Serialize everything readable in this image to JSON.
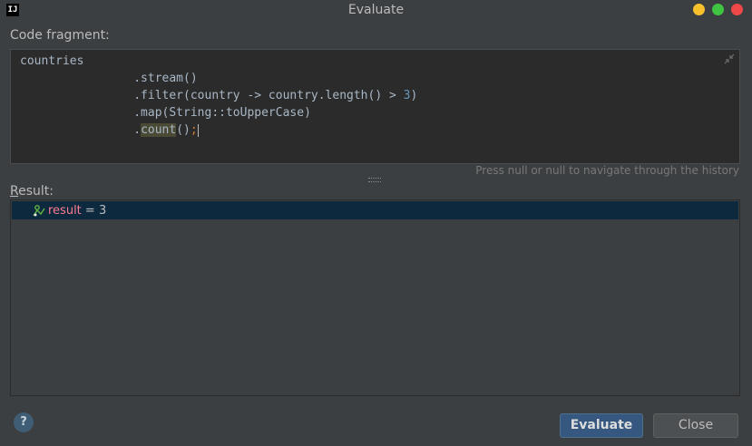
{
  "window": {
    "title": "Evaluate",
    "app_icon_text": "IJ",
    "controls": [
      {
        "name": "minimize",
        "color": "#f7c02c"
      },
      {
        "name": "maximize",
        "color": "#3fc542"
      },
      {
        "name": "close",
        "color": "#f04848"
      }
    ]
  },
  "code_fragment": {
    "label": "Code fragment:",
    "lines": {
      "l1": "countries",
      "l2": "                .stream()",
      "l3a": "                .filter(country -> country.length() > ",
      "l3b": "3",
      "l3c": ")",
      "l4": "                .map(String::toUpperCase)",
      "l5a": "                .",
      "l5b": "count",
      "l5c": "()",
      "l5d": ";"
    }
  },
  "history_hint": "Press null or null to navigate through the history",
  "result": {
    "label_underlined": "R",
    "label_rest": "esult:",
    "name": "result",
    "equals": " = ",
    "value": "3"
  },
  "buttons": {
    "help": "?",
    "evaluate": "Evaluate",
    "close": "Close"
  }
}
